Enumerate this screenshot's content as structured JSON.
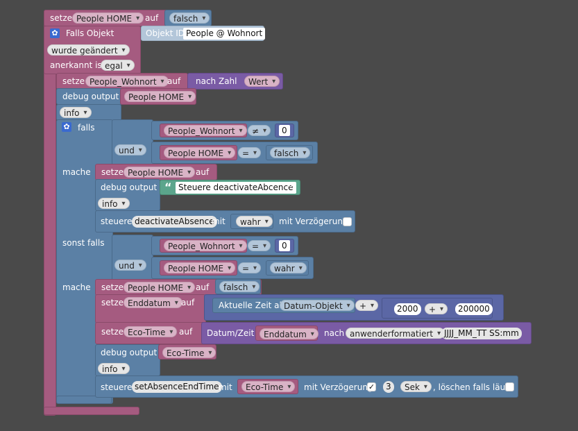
{
  "top": {
    "setze": "setze",
    "var": "People HOME",
    "auf": "auf",
    "value": "falsch"
  },
  "trigger": {
    "falls_objekt": "Falls Objekt",
    "objekt_id": "Objekt ID",
    "objekt_value": "People @ Wohnort",
    "changed_mode": "wurde geändert",
    "ack_label": "anerkannt ist",
    "ack_value": "egal"
  },
  "setze_wohnort": {
    "setze": "setze",
    "var": "People_Wohnort",
    "auf": "auf",
    "nach_zahl": "nach Zahl",
    "wert": "Wert"
  },
  "debug1": {
    "label": "debug output",
    "var": "People HOME",
    "level": "info"
  },
  "if_block": {
    "falls": "falls",
    "cond1": {
      "var": "People_Wohnort",
      "op": "≠",
      "num": "0"
    },
    "und": "und",
    "cond2": {
      "var": "People HOME",
      "op": "=",
      "val": "falsch"
    },
    "mache": "mache",
    "do1": {
      "setze": "setze",
      "var": "People HOME",
      "auf": "auf",
      "debug_label": "debug output",
      "debug_text": "Steuere deactivateAbcence",
      "level": "info",
      "steuere": "steuere",
      "target": "deactivateAbsence",
      "mit": "mit",
      "value": "wahr",
      "delay": "mit Verzögerung"
    },
    "sonst_falls": "sonst falls",
    "cond3": {
      "var": "People_Wohnort",
      "op": "=",
      "num": "0"
    },
    "cond4": {
      "var": "People HOME",
      "op": "=",
      "val": "wahr"
    },
    "mache2": "mache",
    "do2": {
      "setze1": "setze",
      "var1": "People HOME",
      "auf1": "auf",
      "val1": "falsch",
      "setze2": "setze",
      "var2": "Enddatum",
      "auf2": "auf",
      "zeit": "Aktuelle Zeit als",
      "zeit_fmt": "Datum-Objekt",
      "plus": "+",
      "n1": "2000",
      "plus2": "+",
      "n2": "200000",
      "setze3": "setze",
      "var3": "Eco-Time",
      "auf3": "auf",
      "datum": "Datum/Zeit",
      "datum_var": "Enddatum",
      "nach": "nach",
      "format_mode": "anwenderformatiert",
      "format": "JJJJ_MM_TT SS:mm",
      "debug_label": "debug output",
      "debug_var": "Eco-Time",
      "level": "info",
      "steuere": "steuere",
      "target": "setAbsenceEndTime",
      "mit": "mit",
      "var4": "Eco-Time",
      "delay": "mit Verzögerung",
      "delay_check": "✓",
      "delay_n": "3",
      "unit": "Sek",
      "loeschen": ", löschen falls läuft"
    }
  }
}
